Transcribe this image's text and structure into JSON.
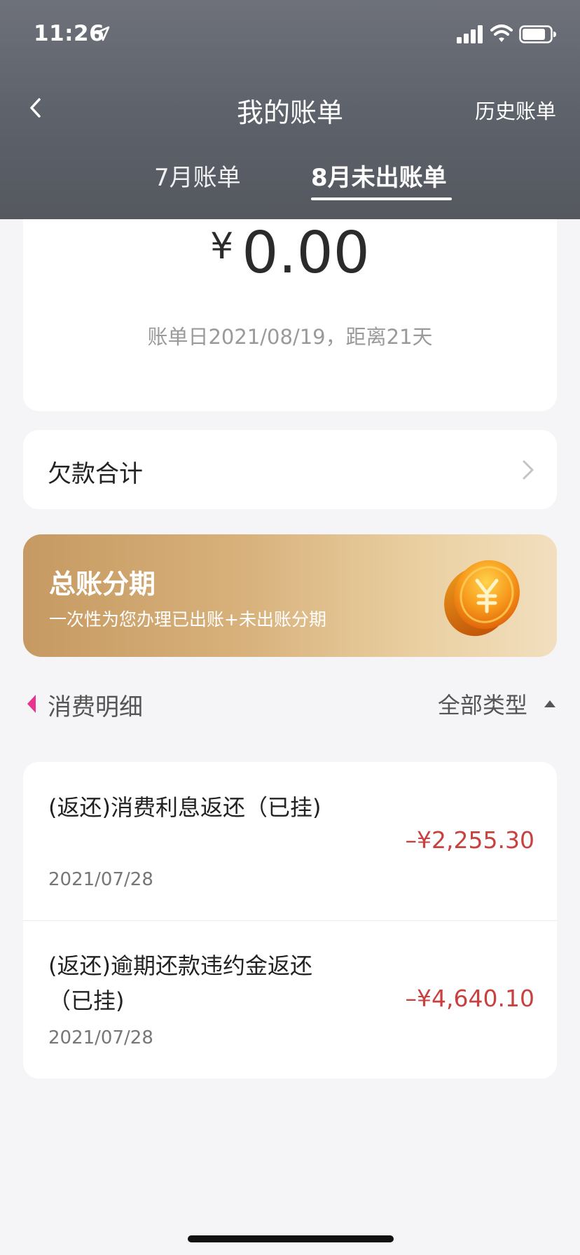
{
  "status_bar": {
    "time": "11:26"
  },
  "nav": {
    "title": "我的账单",
    "history_label": "历史账单"
  },
  "tabs": [
    {
      "label": "7月账单",
      "selected": false
    },
    {
      "label": "8月未出账单",
      "selected": true
    }
  ],
  "bill": {
    "currency_symbol": "¥",
    "amount": "0.00",
    "date_text": "账单日2021/08/19，距离21天"
  },
  "debt": {
    "label": "欠款合计"
  },
  "banner": {
    "title": "总账分期",
    "subtitle": "一次性为您办理已出账+未出账分期"
  },
  "details": {
    "title": "消费明细",
    "filter_label": "全部类型"
  },
  "transactions": [
    {
      "title": "(返还)消费利息返还（已挂)",
      "date": "2021/07/28",
      "amount": "–¥2,255.30"
    },
    {
      "title": "(返还)逾期还款违约金返还（已挂)",
      "date": "2021/07/28",
      "amount": "–¥4,640.10"
    }
  ],
  "colors": {
    "header_bg": "#5d616a",
    "amount_negative": "#c9413f",
    "accent_pink": "#e8348f",
    "banner_gold": "#d7b07a"
  }
}
